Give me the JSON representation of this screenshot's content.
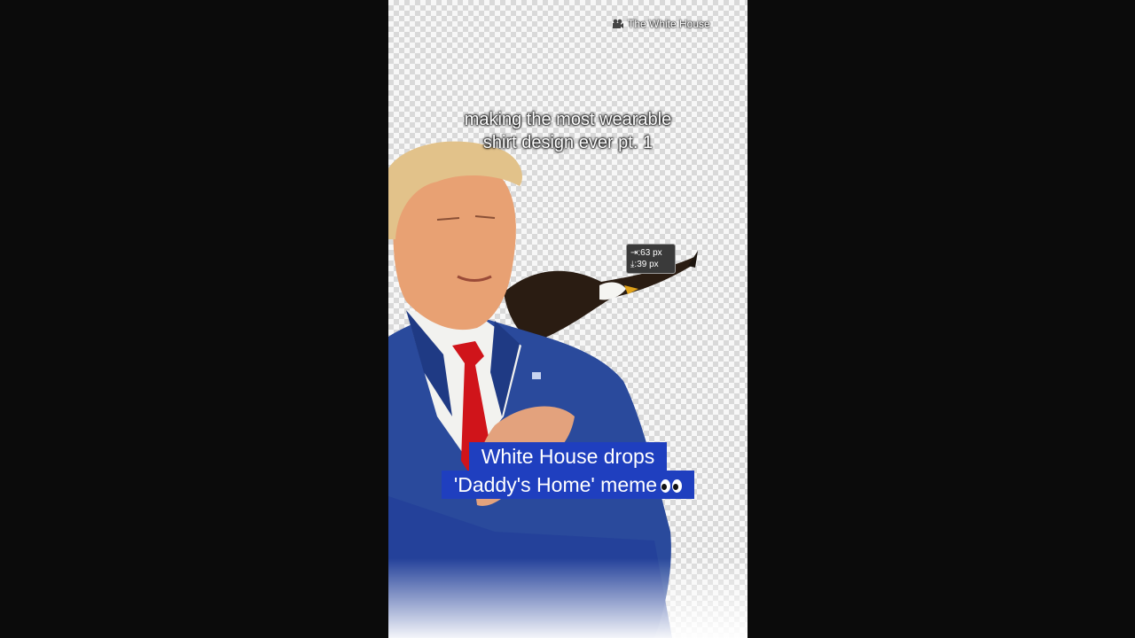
{
  "watermark": {
    "label": "The White House",
    "icon": "video-camera-icon"
  },
  "caption": {
    "text": "making the most wearable\nshirt design ever pt. 1"
  },
  "measurement_tooltip": {
    "horizontal": "63 px",
    "vertical": "39 px",
    "h_symbol": "⇥:",
    "v_symbol": "⤓:"
  },
  "news_banner": {
    "line1": "White House drops",
    "line2": "'Daddy's Home' meme",
    "emoji": "eyes-emoji"
  },
  "colors": {
    "banner_bg": "#1f3fbf",
    "background": "#0b0b0b",
    "checker_dark": "#d9d9d9",
    "checker_light": "#f7f7f7"
  }
}
